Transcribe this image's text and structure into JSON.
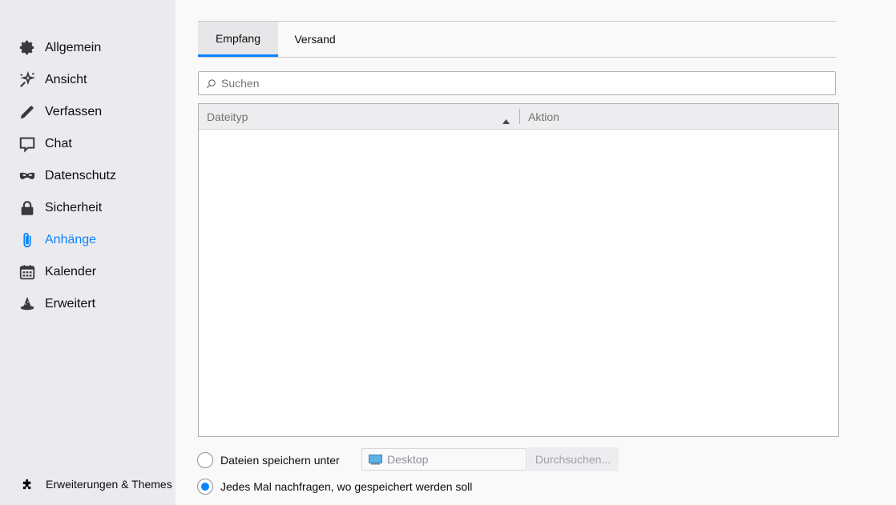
{
  "sidebar": {
    "items": [
      {
        "label": "Allgemein",
        "icon": "gear-icon"
      },
      {
        "label": "Ansicht",
        "icon": "sparkle-icon"
      },
      {
        "label": "Verfassen",
        "icon": "pencil-icon"
      },
      {
        "label": "Chat",
        "icon": "chat-bubble-icon"
      },
      {
        "label": "Datenschutz",
        "icon": "mask-icon"
      },
      {
        "label": "Sicherheit",
        "icon": "lock-icon"
      },
      {
        "label": "Anhänge",
        "icon": "paperclip-icon",
        "active": true
      },
      {
        "label": "Kalender",
        "icon": "calendar-icon"
      },
      {
        "label": "Erweitert",
        "icon": "wizard-hat-icon"
      }
    ],
    "extensions_label": "Erweiterungen & Themes"
  },
  "tabs": [
    {
      "label": "Empfang",
      "selected": true
    },
    {
      "label": "Versand",
      "selected": false
    }
  ],
  "search": {
    "placeholder": "Suchen",
    "value": ""
  },
  "table": {
    "columns": [
      "Dateityp",
      "Aktion"
    ],
    "rows": []
  },
  "save": {
    "option_save_to": "Dateien speichern unter",
    "folder_value": "Desktop",
    "browse_label": "Durchsuchen...",
    "option_ask": "Jedes Mal nachfragen, wo gespeichert werden soll",
    "selected_option": "ask"
  },
  "colors": {
    "accent": "#0a84ff",
    "sidebar_bg": "#ebebef",
    "page_bg": "#f9f9fa"
  }
}
